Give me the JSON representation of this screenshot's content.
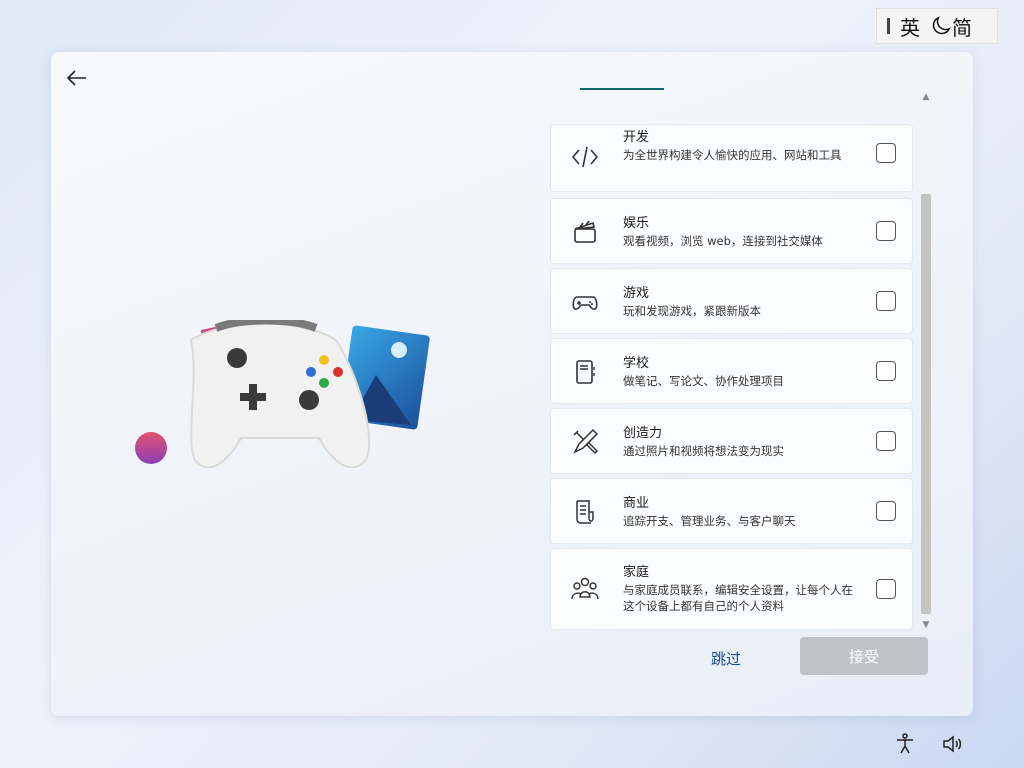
{
  "ime": {
    "mode": "英",
    "lang": "简"
  },
  "categories": [
    {
      "title": "开发",
      "desc": "为全世界构建令人愉快的应用、网站和工具",
      "icon": "code-icon"
    },
    {
      "title": "娱乐",
      "desc": "观看视频，浏览 web，连接到社交媒体",
      "icon": "clapperboard-icon"
    },
    {
      "title": "游戏",
      "desc": "玩和发现游戏，紧跟新版本",
      "icon": "gamepad-icon"
    },
    {
      "title": "学校",
      "desc": "做笔记、写论文、协作处理项目",
      "icon": "notebook-icon"
    },
    {
      "title": "创造力",
      "desc": "通过照片和视频将想法变为现实",
      "icon": "pen-brush-icon"
    },
    {
      "title": "商业",
      "desc": "追踪开支、管理业务、与客户聊天",
      "icon": "document-icon"
    },
    {
      "title": "家庭",
      "desc": "与家庭成员联系，编辑安全设置，让每个人在这个设备上都有自己的个人资料",
      "icon": "people-icon"
    }
  ],
  "actions": {
    "skip": "跳过",
    "accept": "接受"
  },
  "colors": {
    "accent": "#0e6b6b",
    "link": "#1a4a8a",
    "disabled": "#bfc3c9"
  }
}
